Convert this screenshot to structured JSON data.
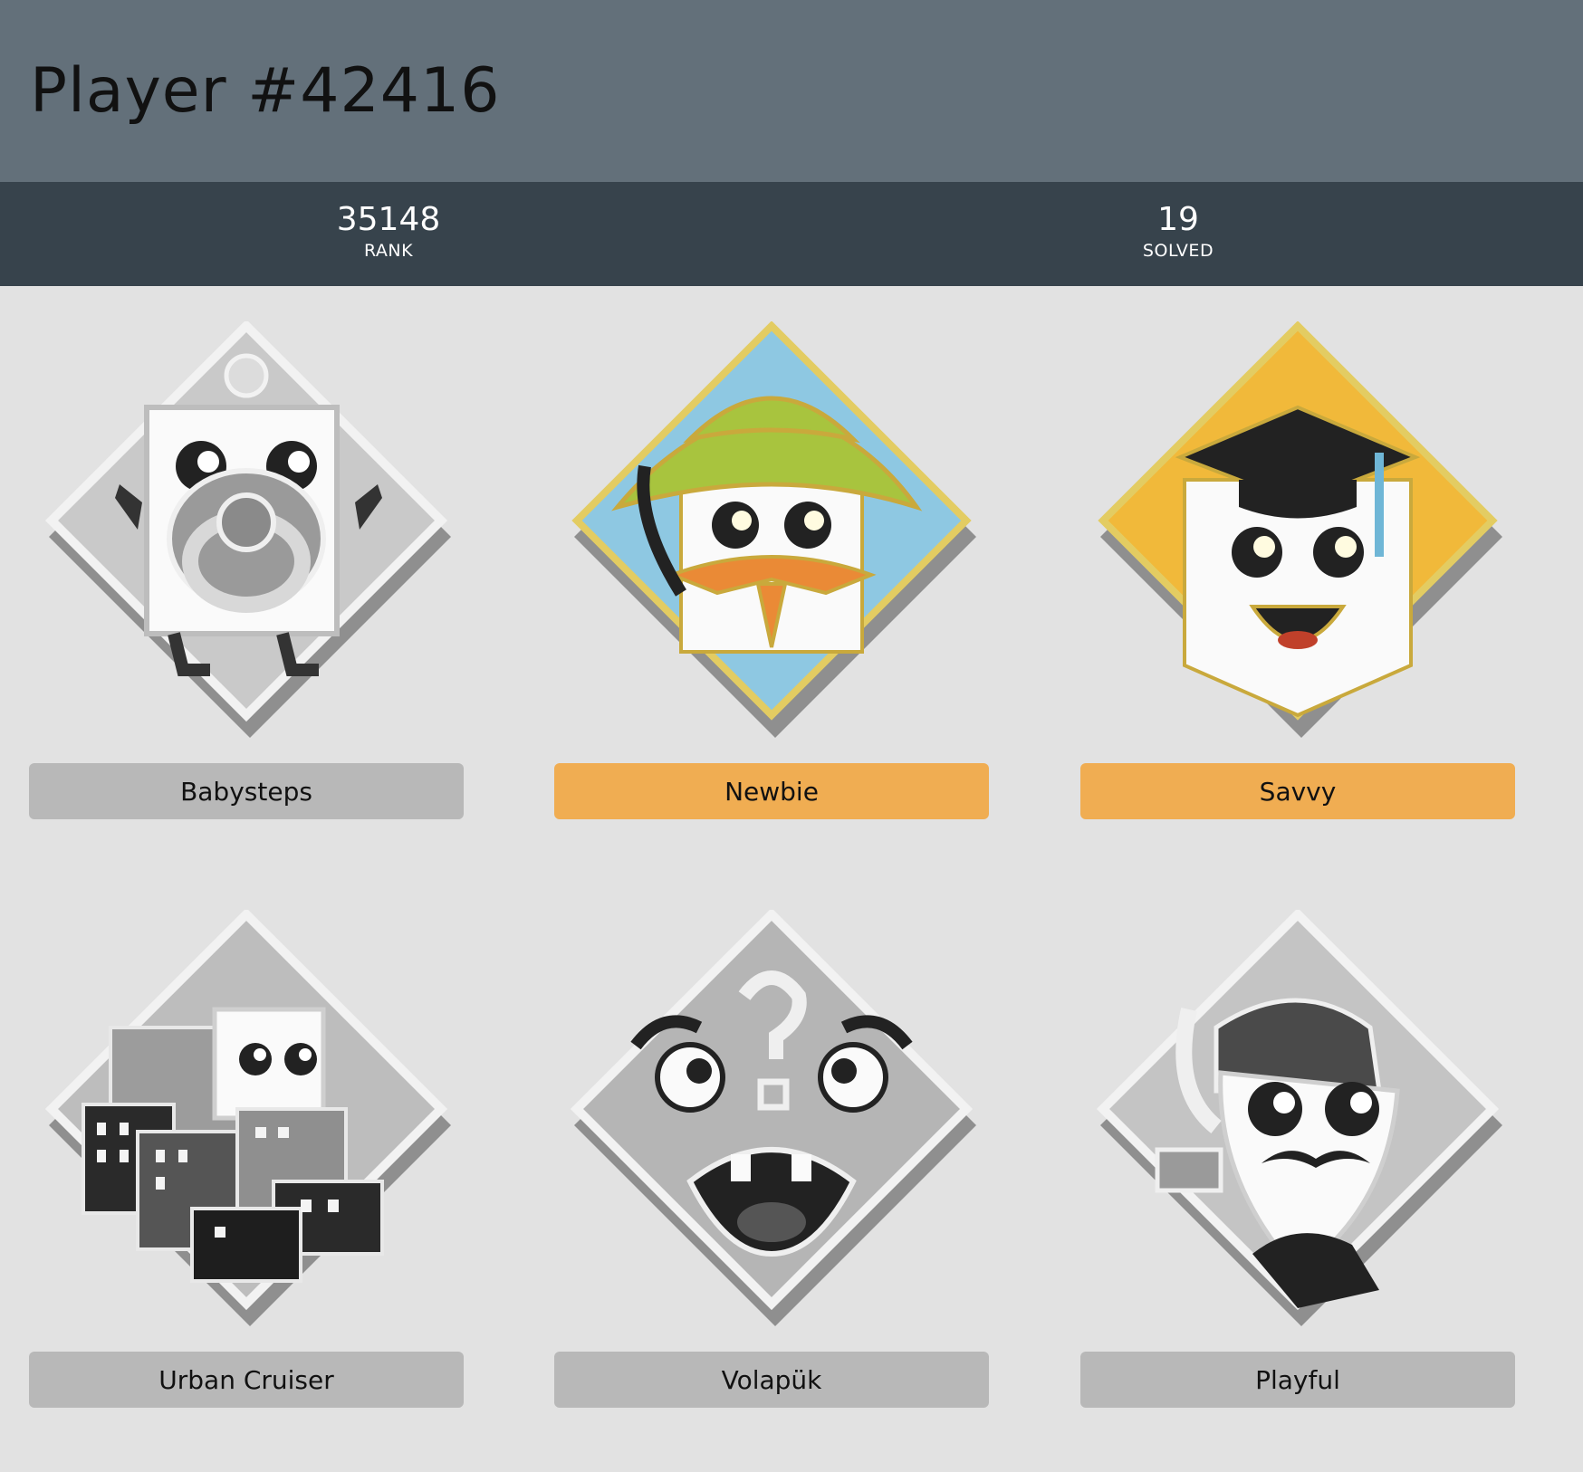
{
  "player": {
    "title": "Player #42416"
  },
  "stats": [
    {
      "value": "35148",
      "label": "RANK"
    },
    {
      "value": "19",
      "label": "SOLVED"
    }
  ],
  "badges": [
    {
      "name": "Babysteps",
      "earned": false,
      "icon": "baby-pacifier-icon"
    },
    {
      "name": "Newbie",
      "earned": true,
      "icon": "scout-hat-icon"
    },
    {
      "name": "Savvy",
      "earned": true,
      "icon": "graduation-cap-icon"
    },
    {
      "name": "Urban Cruiser",
      "earned": false,
      "icon": "city-skyline-icon"
    },
    {
      "name": "Volapük",
      "earned": false,
      "icon": "confused-question-icon"
    },
    {
      "name": "Playful",
      "earned": false,
      "icon": "mustache-hat-icon"
    }
  ],
  "colors": {
    "header_bg": "#63707a",
    "stats_bg": "#37434c",
    "page_bg": "#e2e2e2",
    "earned_label": "#f0ad52",
    "locked_label": "#b8b8b8",
    "gold_rim": "#e3cc62",
    "newbie_sky": "#8ec8e2",
    "newbie_hat": "#a8c43e",
    "newbie_scarf": "#ea8a36",
    "savvy_bg": "#f1b93a"
  }
}
